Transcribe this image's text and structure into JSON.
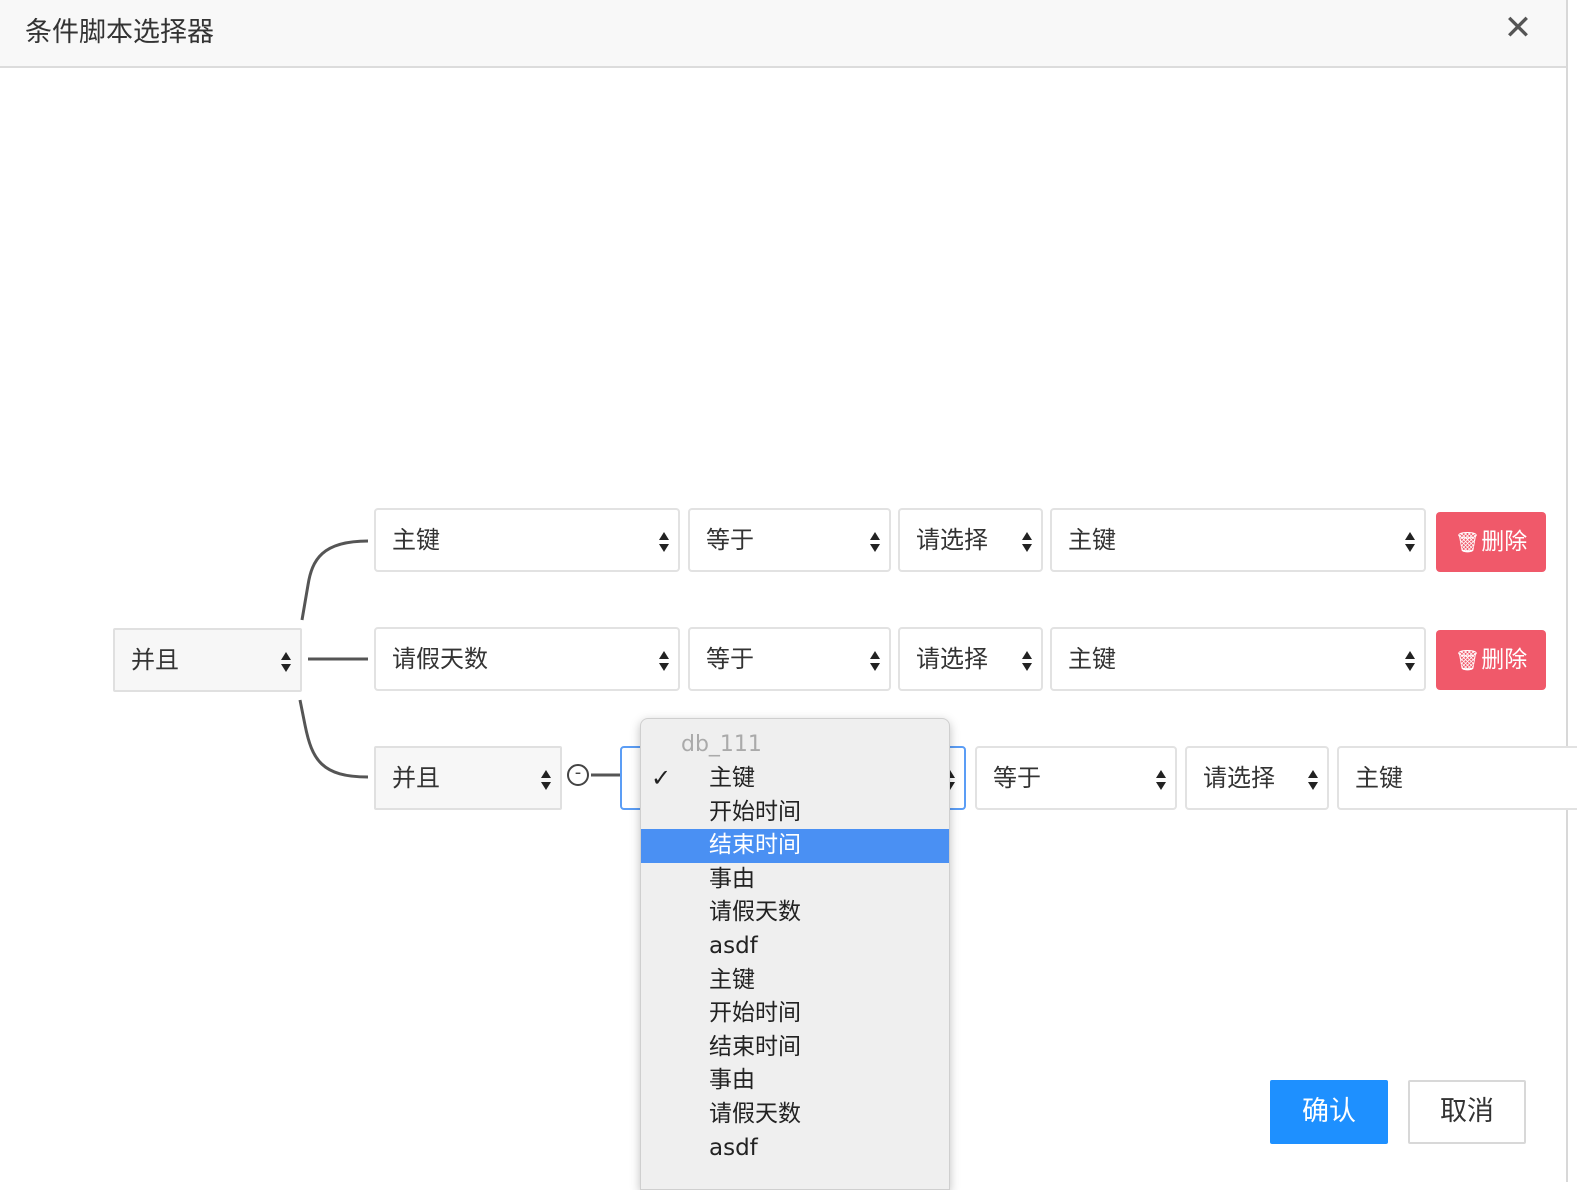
{
  "dialog": {
    "title": "条件脚本选择器"
  },
  "root": {
    "operator": "并且"
  },
  "rows": [
    {
      "field": "主键",
      "op": "等于",
      "type": "请选择",
      "value": "主键",
      "delete_label": "删除"
    },
    {
      "field": "请假天数",
      "op": "等于",
      "type": "请选择",
      "value": "主键",
      "delete_label": "删除"
    }
  ],
  "nested": {
    "operator": "并且",
    "remove_glyph": "-",
    "row": {
      "op": "等于",
      "type": "请选择",
      "value": "主键"
    }
  },
  "dropdown": {
    "group_label": "db_111",
    "checkmark": "✓",
    "items": [
      "主键",
      "开始时间",
      "结束时间",
      "事由",
      "请假天数",
      "asdf",
      "主键",
      "开始时间",
      "结束时间",
      "事由",
      "请假天数",
      "asdf"
    ],
    "checked_index": 0,
    "highlighted_index": 2
  },
  "footer": {
    "confirm_label": "确认",
    "cancel_label": "取消"
  },
  "colors": {
    "primary": "#1e90ff",
    "danger": "#f0596a",
    "highlight": "#4a90f3"
  }
}
